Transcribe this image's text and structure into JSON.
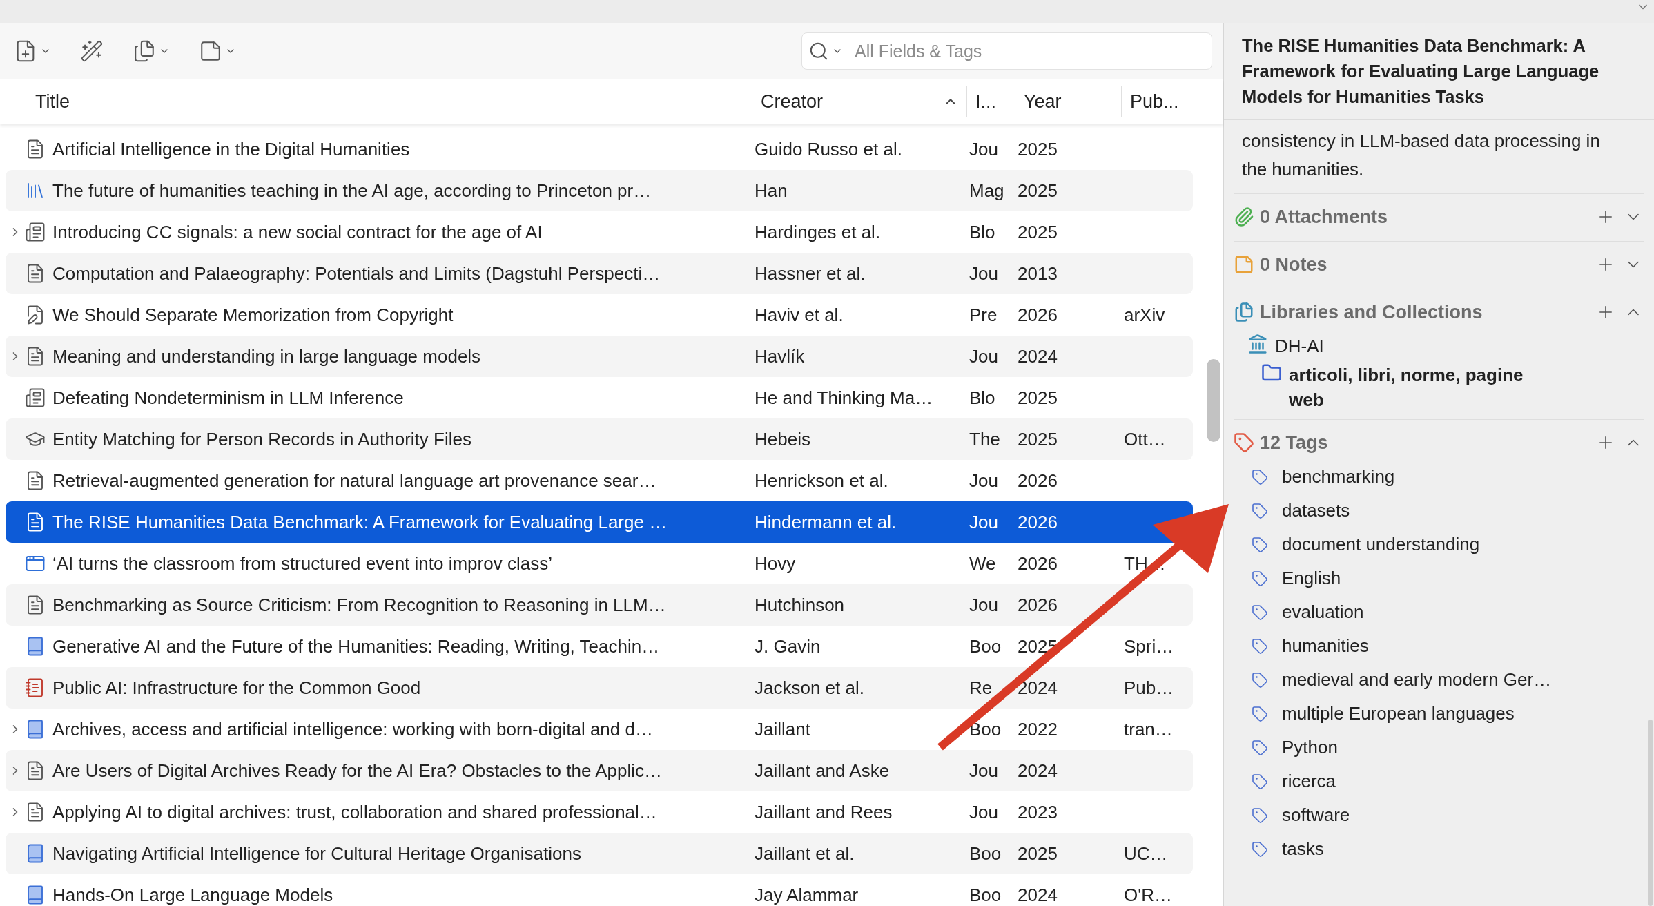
{
  "toolbar": {
    "search": {
      "placeholder": "All Fields & Tags"
    }
  },
  "table": {
    "columns": [
      {
        "label": "Title",
        "sorted": false
      },
      {
        "label": "Creator",
        "sorted": true
      },
      {
        "label": "I...",
        "sorted": false
      },
      {
        "label": "Year",
        "sorted": false
      },
      {
        "label": "Pub...",
        "sorted": false
      }
    ],
    "rows": [
      {
        "kind": "document",
        "title": "Artificial Intelligence in the Digital Humanities",
        "creator": "Guido Russo et al.",
        "type": "Jou",
        "year": "2025",
        "pub": "",
        "selected": false
      },
      {
        "kind": "magazine",
        "title": "The future of humanities teaching in the AI age, according to Princeton pr…",
        "creator": "Han",
        "type": "Mag",
        "year": "2025",
        "pub": "",
        "selected": false
      },
      {
        "kind": "blog",
        "expanded": false,
        "title": "Introducing CC signals: a new social contract for the age of AI",
        "creator": "Hardinges et al.",
        "type": "Blo",
        "year": "2025",
        "pub": "",
        "selected": false
      },
      {
        "kind": "document",
        "title": "Computation and Palaeography: Potentials and Limits (Dagstuhl Perspecti…",
        "creator": "Hassner et al.",
        "type": "Jou",
        "year": "2013",
        "pub": "",
        "selected": false
      },
      {
        "kind": "preprint",
        "title": "We Should Separate Memorization from Copyright",
        "creator": "Haviv et al.",
        "type": "Pre",
        "year": "2026",
        "pub": "arXiv",
        "selected": false
      },
      {
        "kind": "document",
        "expanded": false,
        "title": "Meaning and understanding in large language models",
        "creator": "Havlík",
        "type": "Jou",
        "year": "2024",
        "pub": "",
        "selected": false
      },
      {
        "kind": "blog",
        "title": "Defeating Nondeterminism in LLM Inference",
        "creator": "He and Thinking Ma…",
        "type": "Blo",
        "year": "2025",
        "pub": "",
        "selected": false
      },
      {
        "kind": "thesis",
        "title": "Entity Matching for Person Records in Authority Files",
        "creator": "Hebeis",
        "type": "The",
        "year": "2025",
        "pub": "Ott…",
        "selected": false
      },
      {
        "kind": "document",
        "title": "Retrieval-augmented generation for natural language art provenance sear…",
        "creator": "Henrickson et al.",
        "type": "Jou",
        "year": "2026",
        "pub": "",
        "selected": false
      },
      {
        "kind": "document",
        "title": "The RISE Humanities Data Benchmark: A Framework for Evaluating Large …",
        "creator": "Hindermann et al.",
        "type": "Jou",
        "year": "2026",
        "pub": "",
        "selected": true
      },
      {
        "kind": "webpage",
        "title": "‘AI turns the classroom from structured event into improv class’",
        "creator": "Hovy",
        "type": "We",
        "year": "2026",
        "pub": "TH…",
        "selected": false
      },
      {
        "kind": "document",
        "title": "Benchmarking as Source Criticism: From Recognition to Reasoning in LLM…",
        "creator": "Hutchinson",
        "type": "Jou",
        "year": "2026",
        "pub": "",
        "selected": false
      },
      {
        "kind": "book",
        "title": "Generative AI and the Future of the Humanities: Reading, Writing, Teachin…",
        "creator": "J. Gavin",
        "type": "Boo",
        "year": "2025",
        "pub": "Spri…",
        "selected": false
      },
      {
        "kind": "report",
        "title": "Public AI: Infrastructure for the Common Good",
        "creator": "Jackson et al.",
        "type": "Re",
        "year": "2024",
        "pub": "Pub…",
        "selected": false
      },
      {
        "kind": "book",
        "expanded": false,
        "title": "Archives, access and artificial intelligence: working with born-digital and d…",
        "creator": "Jaillant",
        "type": "Boo",
        "year": "2022",
        "pub": "tran…",
        "selected": false
      },
      {
        "kind": "document",
        "expanded": false,
        "title": "Are Users of Digital Archives Ready for the AI Era? Obstacles to the Applic…",
        "creator": "Jaillant and Aske",
        "type": "Jou",
        "year": "2024",
        "pub": "",
        "selected": false
      },
      {
        "kind": "document",
        "expanded": false,
        "title": "Applying AI to digital archives: trust, collaboration and shared professional…",
        "creator": "Jaillant and Rees",
        "type": "Jou",
        "year": "2023",
        "pub": "",
        "selected": false
      },
      {
        "kind": "book",
        "title": "Navigating Artificial Intelligence for Cultural Heritage Organisations",
        "creator": "Jaillant et al.",
        "type": "Boo",
        "year": "2025",
        "pub": "UC…",
        "selected": false
      },
      {
        "kind": "book",
        "title": "Hands-On Large Language Models",
        "creator": "Jay Alammar",
        "type": "Boo",
        "year": "2024",
        "pub": "O'R…",
        "selected": false
      }
    ]
  },
  "item_pane": {
    "title": "The RISE Humanities Data Benchmark: A Framework for Evaluating Large Language Models for Humanities Tasks",
    "abstract": "consistency in LLM-based data processing in the humanities.",
    "sections": [
      {
        "kind": "attachments",
        "label": "0 Attachments",
        "expanded": false
      },
      {
        "kind": "notes",
        "label": "0 Notes",
        "expanded": false
      },
      {
        "kind": "collections",
        "label": "Libraries and Collections",
        "expanded": true,
        "library": "DH-AI",
        "collections": [
          "articoli, libri, norme, pagine web"
        ]
      },
      {
        "kind": "tags",
        "label": "12 Tags",
        "expanded": true,
        "tags": [
          "benchmarking",
          "datasets",
          "document understanding",
          "English",
          "evaluation",
          "humanities",
          "medieval and early modern Ger…",
          "multiple European languages",
          "Python",
          "ricerca",
          "software",
          "tasks"
        ]
      }
    ]
  }
}
